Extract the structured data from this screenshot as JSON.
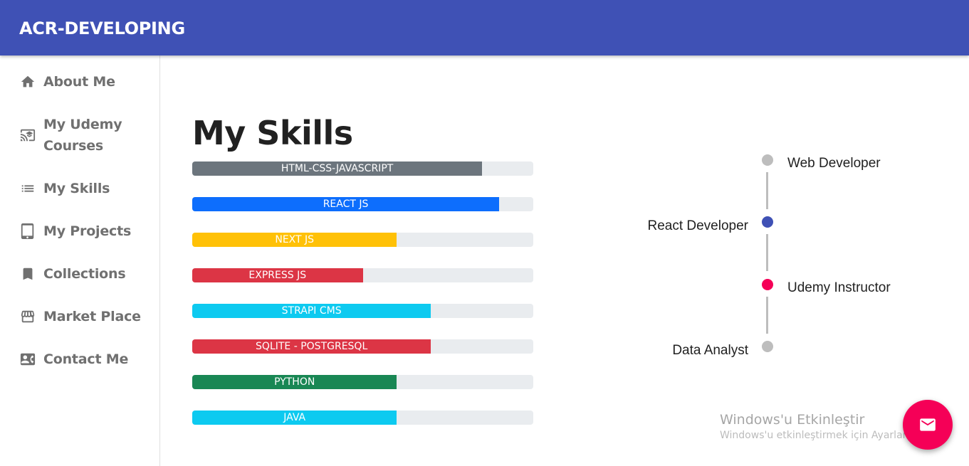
{
  "app": {
    "brand": "ACR-DEVELOPING"
  },
  "sidebar": {
    "items": [
      {
        "label": "About Me",
        "icon": "home-icon"
      },
      {
        "label": "My Udemy Courses",
        "line1": "My Udemy",
        "line2": "Courses",
        "icon": "cast-for-education-icon"
      },
      {
        "label": "My Skills",
        "icon": "list-icon"
      },
      {
        "label": "My Projects",
        "icon": "tablet-icon"
      },
      {
        "label": "Collections",
        "icon": "bookmark-icon"
      },
      {
        "label": "Market Place",
        "icon": "store-icon"
      },
      {
        "label": "Contact Me",
        "icon": "contact-card-icon"
      }
    ]
  },
  "main": {
    "title": "My Skills",
    "skills": [
      {
        "label": "HTML-CSS-JAVASCRIPT",
        "percent": 85,
        "color": "#6c757d"
      },
      {
        "label": "REACT JS",
        "percent": 90,
        "color": "#0d6efd"
      },
      {
        "label": "NEXT JS",
        "percent": 60,
        "color": "#ffc107"
      },
      {
        "label": "EXPRESS JS",
        "percent": 50,
        "color": "#dc3545"
      },
      {
        "label": "STRAPI CMS",
        "percent": 70,
        "color": "#0dcaf0"
      },
      {
        "label": "SQLITE - POSTGRESQL",
        "percent": 70,
        "color": "#dc3545"
      },
      {
        "label": "PYTHON",
        "percent": 60,
        "color": "#198754"
      },
      {
        "label": "JAVA",
        "percent": 60,
        "color": "#0dcaf0"
      }
    ],
    "timeline": [
      {
        "label": "Web Developer",
        "color": "#bdbdbd",
        "side": "right"
      },
      {
        "label": "React Developer",
        "color": "#3f51b5",
        "side": "left"
      },
      {
        "label": "Udemy Instructor",
        "color": "#f50057",
        "side": "right"
      },
      {
        "label": "Data Analyst",
        "color": "#bdbdbd",
        "side": "left"
      }
    ]
  },
  "watermark": {
    "title": "Windows'u Etkinleştir",
    "subtitle": "Windows'u etkinleştirmek için Ayarlar'a gidin."
  },
  "fab": {
    "icon": "mail-icon",
    "color": "#f50057"
  }
}
